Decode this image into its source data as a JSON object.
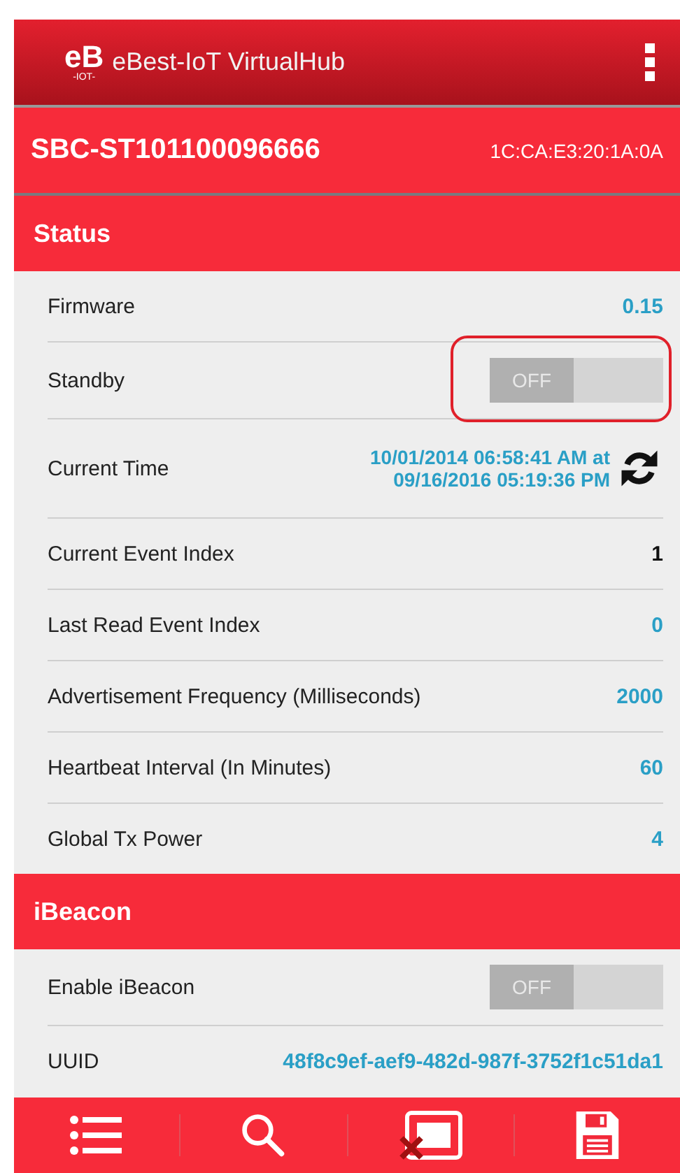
{
  "app_bar": {
    "title": "eBest-IoT VirtualHub",
    "logo_main": "eB",
    "logo_sub": "-IOT-"
  },
  "device": {
    "name": "SBC-ST101100096666",
    "address": "1C:CA:E3:20:1A:0A"
  },
  "sections": [
    {
      "title": "Status",
      "rows": [
        {
          "kind": "value",
          "label": "Firmware",
          "value": "0.15",
          "color": "#2a9fc6",
          "highlighted": false
        },
        {
          "kind": "toggle",
          "label": "Standby",
          "on": false,
          "state_text": "OFF",
          "highlighted": true
        },
        {
          "kind": "time",
          "label": "Current Time",
          "lines": [
            "10/01/2014 06:58:41 AM at",
            "09/16/2016 05:19:36 PM"
          ],
          "highlighted": false
        },
        {
          "kind": "value",
          "label": "Current Event Index",
          "value": "1",
          "color": "#111111",
          "highlighted": false
        },
        {
          "kind": "value",
          "label": "Last Read Event Index",
          "value": "0",
          "color": "#2a9fc6",
          "highlighted": false
        },
        {
          "kind": "value",
          "label": "Advertisement Frequency (Milliseconds)",
          "value": "2000",
          "color": "#2a9fc6",
          "highlighted": false
        },
        {
          "kind": "value",
          "label": "Heartbeat Interval (In Minutes)",
          "value": "60",
          "color": "#2a9fc6",
          "highlighted": false
        },
        {
          "kind": "value",
          "label": "Global Tx Power",
          "value": "4",
          "color": "#2a9fc6",
          "highlighted": false
        }
      ]
    },
    {
      "title": "iBeacon",
      "rows": [
        {
          "kind": "toggle",
          "label": "Enable iBeacon",
          "on": false,
          "state_text": "OFF",
          "highlighted": false
        },
        {
          "kind": "value",
          "label": "UUID",
          "value": "48f8c9ef-aef9-482d-987f-3752f1c51da1",
          "color": "#2a9fc6",
          "highlighted": false
        }
      ]
    }
  ],
  "bottom_nav": [
    {
      "kind": "list"
    },
    {
      "kind": "search"
    },
    {
      "kind": "cast"
    },
    {
      "kind": "save"
    }
  ]
}
